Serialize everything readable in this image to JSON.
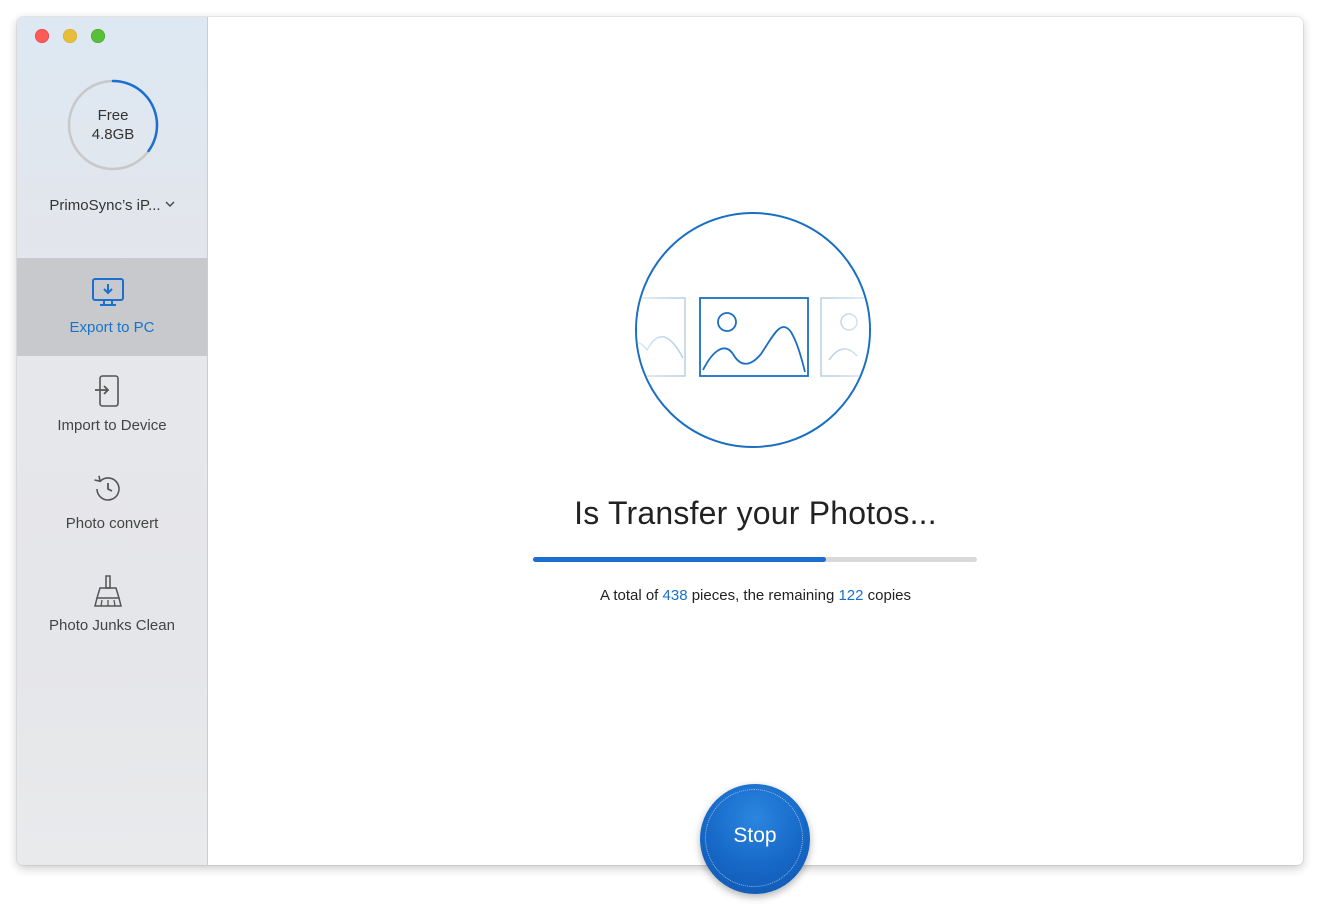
{
  "window": {
    "controls": [
      "close",
      "minimize",
      "maximize"
    ]
  },
  "sidebar": {
    "storage": {
      "line1": "Free",
      "line2": "4.8GB",
      "used_fraction": 0.35
    },
    "device_name": "PrimoSync’s iP...",
    "device_dropdown_icon": "chevron-down-icon",
    "items": [
      {
        "label": "Export to PC",
        "icon": "monitor-download-icon",
        "active": true
      },
      {
        "label": "Import to Device",
        "icon": "device-import-icon",
        "active": false
      },
      {
        "label": "Photo convert",
        "icon": "history-clock-icon",
        "active": false
      },
      {
        "label": "Photo Junks Clean",
        "icon": "broom-icon",
        "active": false
      }
    ]
  },
  "main": {
    "illustration_icon": "photos-transfer-icon",
    "title": "Is Transfer your Photos...",
    "progress": 0.66,
    "status": {
      "prefix": "A total of ",
      "total": "438",
      "middle": " pieces, the remaining ",
      "remaining": "122",
      "suffix": " copies"
    },
    "stop_label": "Stop"
  },
  "colors": {
    "accent": "#1a6fd0",
    "sidebar_active": "#c7c9cd",
    "ring_track": "#c8c8c8"
  }
}
